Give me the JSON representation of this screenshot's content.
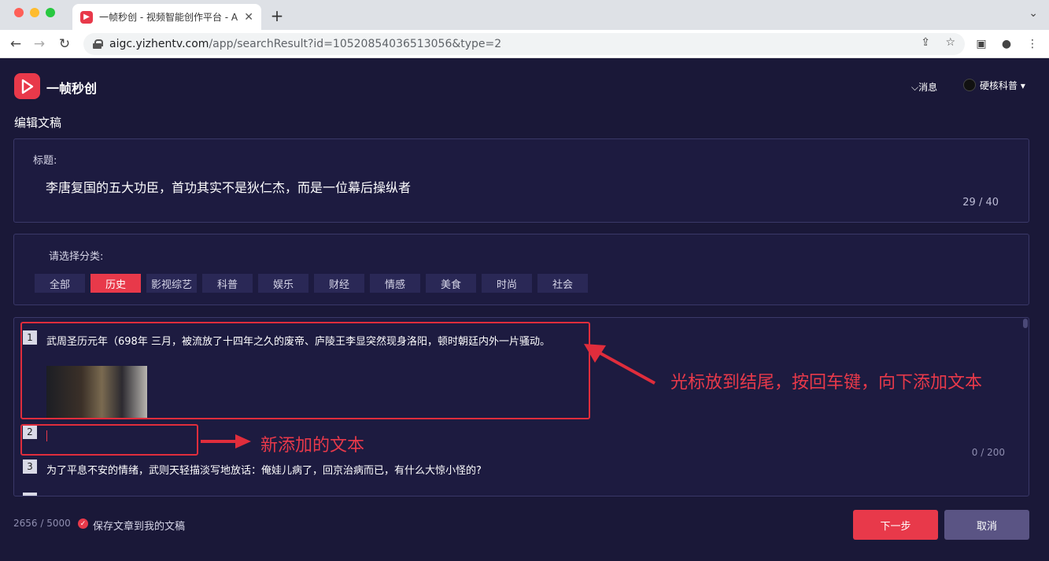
{
  "browser": {
    "tab_title": "一帧秒创 - 视频智能创作平台 - A",
    "url_domain": "aigc.yizhentv.com",
    "url_path": "/app/searchResult?id=10520854036513056&type=2"
  },
  "header": {
    "brand": "一帧秒创",
    "messages": "消息",
    "user": "硬核科普"
  },
  "page_title": "编辑文稿",
  "title_section": {
    "label": "标题:",
    "value": "李唐复国的五大功臣，首功其实不是狄仁杰，而是一位幕后操纵者",
    "counter": "29 / 40"
  },
  "category_section": {
    "label": "请选择分类:",
    "items": [
      "全部",
      "历史",
      "影视综艺",
      "科普",
      "娱乐",
      "财经",
      "情感",
      "美食",
      "时尚",
      "社会"
    ],
    "selected": "历史"
  },
  "paragraphs": [
    {
      "index": "1",
      "text": "武周圣历元年（698年 三月，被流放了十四年之久的废帝、庐陵王李显突然现身洛阳，顿时朝廷内外一片骚动。"
    },
    {
      "index": "2",
      "text": "",
      "counter": "0 / 200"
    },
    {
      "index": "3",
      "text": "为了平息不安的情绪，武则天轻描淡写地放话：俺娃儿病了，回京治病而已，有什么大惊小怪的?"
    }
  ],
  "annotations": {
    "first": "光标放到结尾，按回车键，向下添加文本",
    "second": "新添加的文本"
  },
  "footer": {
    "word_count": "2656 / 5000",
    "save_label": "保存文章到我的文稿",
    "next_button": "下一步",
    "cancel_button": "取消"
  },
  "colors": {
    "accent": "#e8394a",
    "background": "#1a1838",
    "panel": "#1d1b40",
    "cancel": "#5a5484"
  }
}
